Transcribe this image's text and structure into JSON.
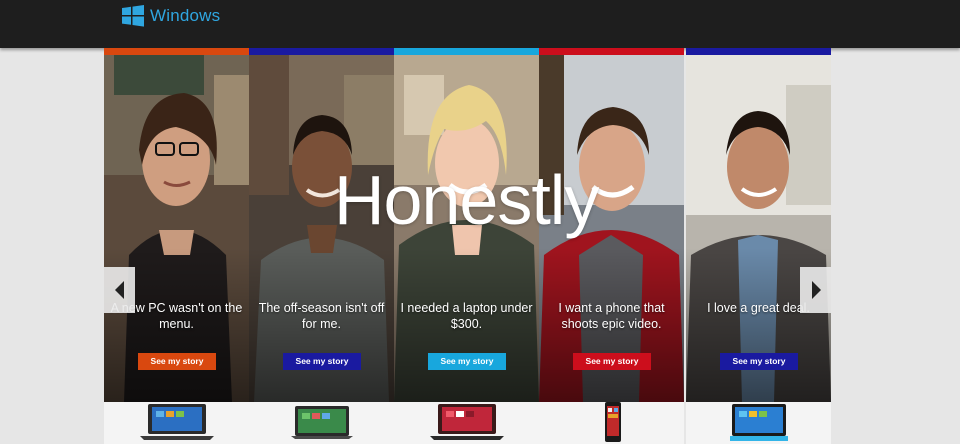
{
  "header": {
    "brand": "Windows",
    "logo_icon": "windows-logo-icon",
    "bar_color": "#1e1e1e",
    "brand_color": "#2fa6e0"
  },
  "hero": {
    "headline": "Honestly",
    "prev_icon": "chevron-left-icon",
    "next_icon": "chevron-right-icon"
  },
  "stories": [
    {
      "quote": "A new PC wasn't on the menu.",
      "button": "See my story",
      "accent": "#d9480f",
      "device": "laptop-icon"
    },
    {
      "quote": "The off-season isn't off for me.",
      "button": "See my story",
      "accent": "#1a1aa0",
      "device": "tablet-icon"
    },
    {
      "quote": "I needed a laptop under $300.",
      "button": "See my story",
      "accent": "#18a7dd",
      "device": "laptop-icon"
    },
    {
      "quote": "I want a phone that shoots epic video.",
      "button": "See my story",
      "accent": "#cc0e1c",
      "device": "phone-icon"
    },
    {
      "quote": "I love a great deal.",
      "button": "See my story",
      "accent": "#1a1aa0",
      "device": "tablet-icon"
    }
  ]
}
